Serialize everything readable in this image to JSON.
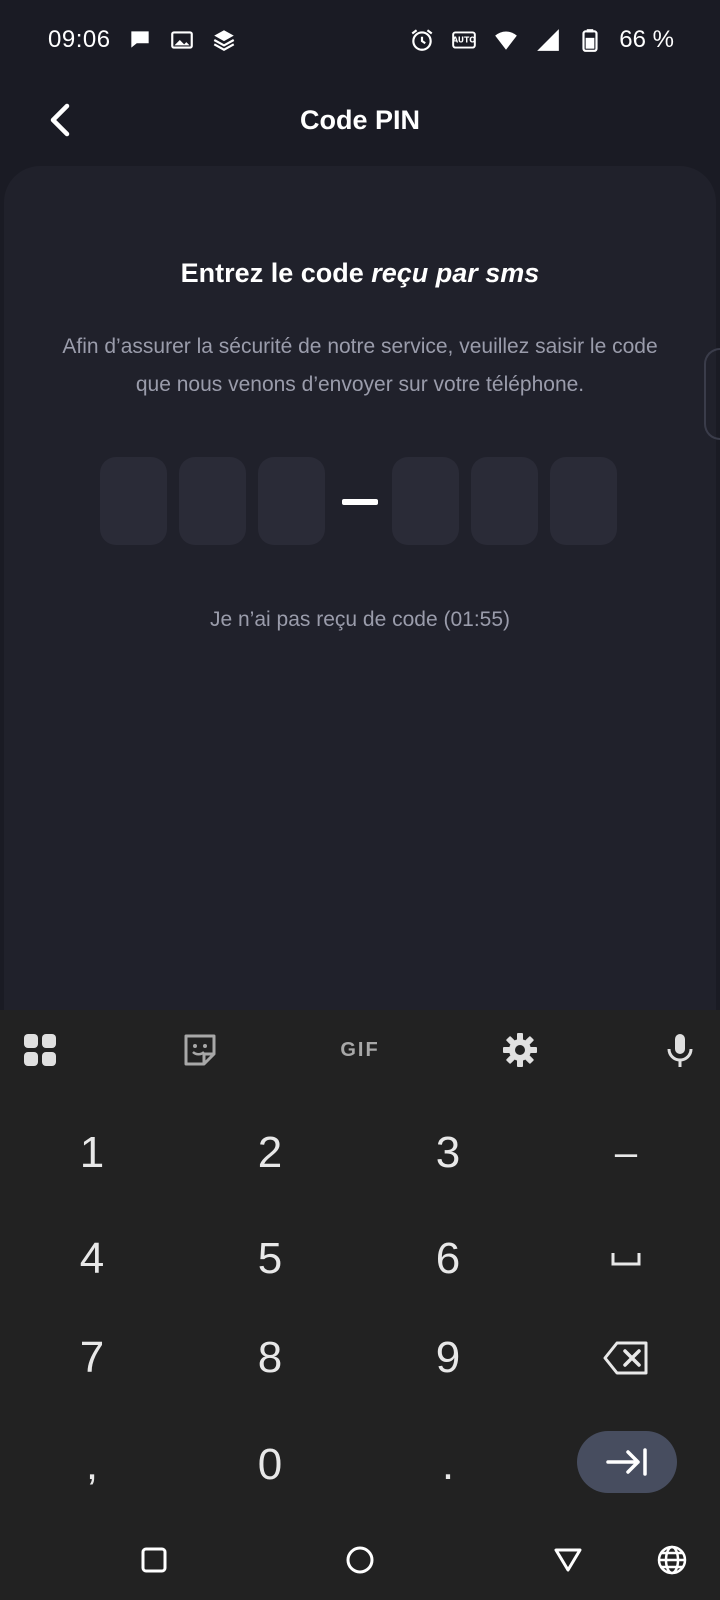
{
  "status_bar": {
    "time": "09:06",
    "battery": "66 %",
    "left_icons": [
      "chat-bubble-icon",
      "image-icon",
      "layers-app-icon"
    ],
    "right_icons": [
      "alarm-icon",
      "auto-hz-icon",
      "wifi-icon",
      "signal-icon",
      "battery-icon"
    ]
  },
  "header": {
    "title": "Code PIN"
  },
  "card": {
    "title_plain": "Entrez le code ",
    "title_italic": "reçu par sms",
    "description": "Afin d’assurer la sécurité de notre service, veuillez saisir le code que nous venons d’envoyer sur votre téléphone.",
    "pin_digits": [
      "",
      "",
      "",
      "",
      "",
      ""
    ],
    "separator": "–",
    "resend": "Je n’ai pas reçu de code (01:55)"
  },
  "keyboard": {
    "toolbar": [
      "apps-grid-icon",
      "sticker-icon",
      "GIF",
      "settings-gear-icon",
      "microphone-icon"
    ],
    "gif_label": "GIF",
    "keys": {
      "k1": "1",
      "k2": "2",
      "k3": "3",
      "dash": "–",
      "k4": "4",
      "k5": "5",
      "k6": "6",
      "space": "␣",
      "k7": "7",
      "k8": "8",
      "k9": "9",
      "comma": ",",
      "k0": "0",
      "period": "."
    }
  },
  "nav_bar": [
    "recents-square-icon",
    "home-circle-icon",
    "back-triangle-icon",
    "globe-icon"
  ],
  "colors": {
    "background": "#1a1b24",
    "card": "#20212b",
    "pin_box": "#2a2b37",
    "muted_text": "#9a9cab",
    "keyboard": "#222222",
    "enter_key": "#474d5f"
  }
}
